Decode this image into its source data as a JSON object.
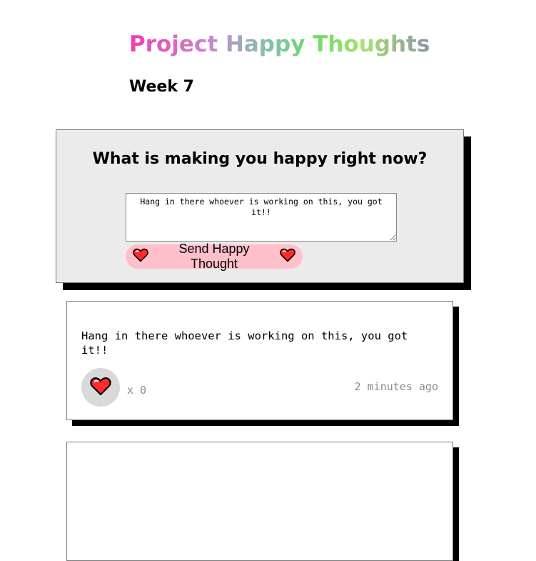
{
  "header": {
    "title": "Project Happy Thoughts",
    "subtitle": "Week 7"
  },
  "form": {
    "question": "What is making you happy right now?",
    "input_value": "Hang in there whoever is working on this, you got it!!",
    "submit_label": "Send Happy Thought",
    "submit_icon": "heart-icon",
    "button_color": "#ffc0cb"
  },
  "thoughts": [
    {
      "message": "Hang in there whoever is working on this, you got it!!",
      "like_count": "x 0",
      "time": "2 minutes ago"
    }
  ],
  "colors": {
    "heart": "#ff2a2a",
    "form_background": "#ebebeb",
    "like_background": "#d9d9d9",
    "shadow": "#000000"
  }
}
